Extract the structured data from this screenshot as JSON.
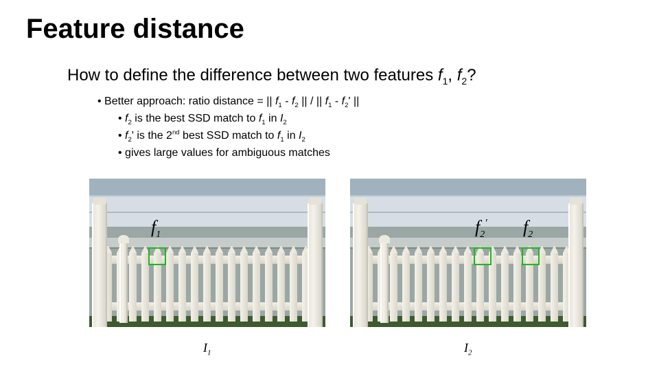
{
  "title": "Feature distance",
  "subtitle": {
    "prefix": "How to define the difference between two features ",
    "f1": "f",
    "s1": "1",
    "comma": ", ",
    "f2": "f",
    "s2": "2",
    "q": "?"
  },
  "bullets": {
    "main_prefix": "Better approach:  ratio distance = || ",
    "f1a": "f",
    "s1a": "1",
    "minus1": " - ",
    "f2a": "f",
    "s2a": "2",
    "mid": " || / || ",
    "f1b": "f",
    "s1b": "1",
    "minus2": " - ",
    "f2p": "f",
    "s2p": "2",
    "prime": "'",
    "end": " ||",
    "b1_a": "f",
    "b1_as": "2",
    "b1_b": " is the best SSD match to ",
    "b1_c": "f",
    "b1_cs": "1",
    "b1_d": " in ",
    "b1_e": "I",
    "b1_es": "2",
    "b2_a": "f",
    "b2_as": "2",
    "b2_ap": "'",
    "b2_b": " is the 2",
    "b2_sup": "nd",
    "b2_c": " best SSD match to ",
    "b2_d": "f",
    "b2_ds": "1",
    "b2_e": " in ",
    "b2_f": "I",
    "b2_fs": "2",
    "b3": "gives large values for ambiguous matches"
  },
  "labels": {
    "f1": "f",
    "f1s": "1",
    "f2p": "f",
    "f2ps": "2",
    "f2pp": "'",
    "f2": "f",
    "f2s": "2",
    "I1": "I",
    "I1s": "1",
    "I2": "I",
    "I2s": "2"
  }
}
